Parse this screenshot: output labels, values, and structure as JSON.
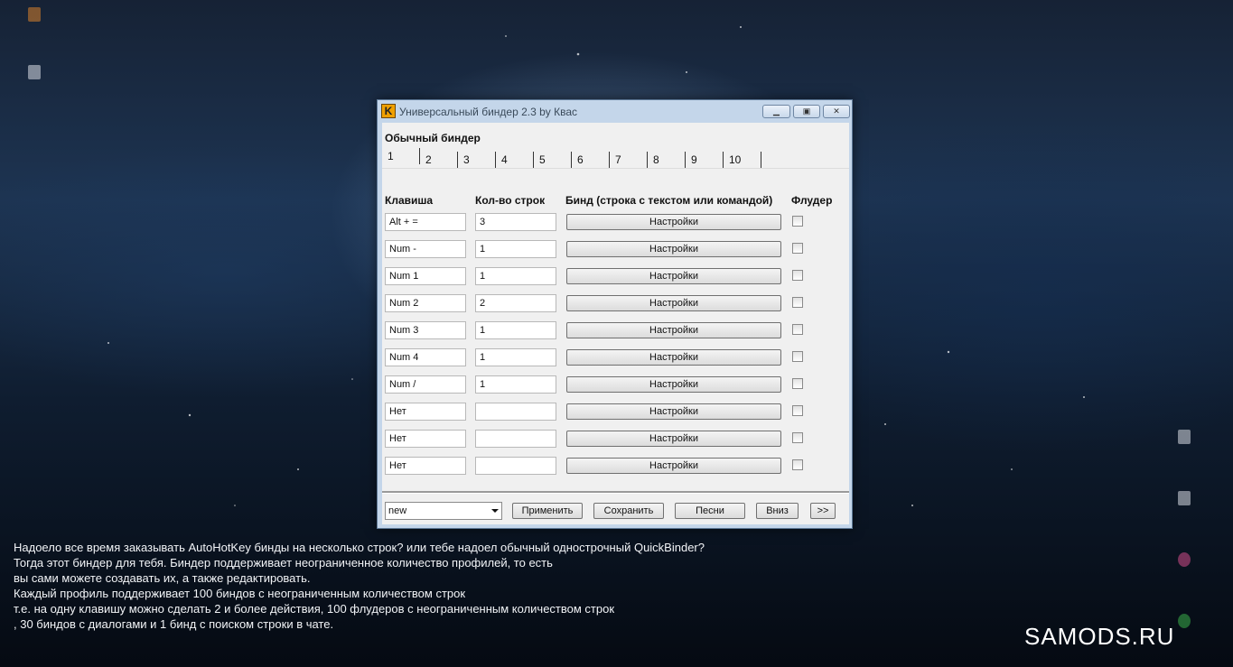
{
  "window": {
    "title": "Универсальный биндер 2.3 by Квас",
    "icon_letter": "K",
    "controls": [
      "minimize-icon",
      "maximize-icon",
      "close-icon"
    ]
  },
  "binder": {
    "group_label": "Обычный биндер",
    "tabs": [
      "1",
      "2",
      "3",
      "4",
      "5",
      "6",
      "7",
      "8",
      "9",
      "10"
    ],
    "active_tab": "1",
    "columns": {
      "key": "Клавиша",
      "count": "Кол-во строк",
      "bind": "Бинд (строка с текстом или командой)",
      "flooder": "Флудер"
    },
    "rows": [
      {
        "key": "Alt + =",
        "count": "3",
        "button": "Настройки",
        "flooder": false
      },
      {
        "key": "Num -",
        "count": "1",
        "button": "Настройки",
        "flooder": false
      },
      {
        "key": "Num 1",
        "count": "1",
        "button": "Настройки",
        "flooder": false
      },
      {
        "key": "Num 2",
        "count": "2",
        "button": "Настройки",
        "flooder": false
      },
      {
        "key": "Num 3",
        "count": "1",
        "button": "Настройки",
        "flooder": false
      },
      {
        "key": "Num 4",
        "count": "1",
        "button": "Настройки",
        "flooder": false
      },
      {
        "key": "Num /",
        "count": "1",
        "button": "Настройки",
        "flooder": false
      },
      {
        "key": "Нет",
        "count": "",
        "button": "Настройки",
        "flooder": false
      },
      {
        "key": "Нет",
        "count": "",
        "button": "Настройки",
        "flooder": false
      },
      {
        "key": "Нет",
        "count": "",
        "button": "Настройки",
        "flooder": false
      }
    ]
  },
  "footer": {
    "profile": "new",
    "apply": "Применить",
    "save": "Сохранить",
    "songs": "Песни",
    "down": "Вниз",
    "next": ">>"
  },
  "caption": [
    "Надоело все время заказывать AutoHotKey бинды на несколько строк? или тебе надоел обычный однострочный QuickBinder?",
    "Тогда этот биндер для тебя. Биндер поддерживает неограниченное количество профилей, то есть",
    "вы сами можете создавать их, а также редактировать.",
    "Каждый профиль поддерживает 100 биндов с неограниченным количеством строк",
    "т.е. на одну клавишу можно сделать 2 и более действия, 100 флудеров с неограниченным количеством строк",
    ", 30 биндов с диалогами и 1 бинд с поиском строки в чате."
  ],
  "watermark": "SAMODS.RU",
  "colors": {
    "window_frame": "#c4d6ea",
    "client_bg": "#f0f0f0",
    "desktop_dark": "#0f1d30"
  }
}
